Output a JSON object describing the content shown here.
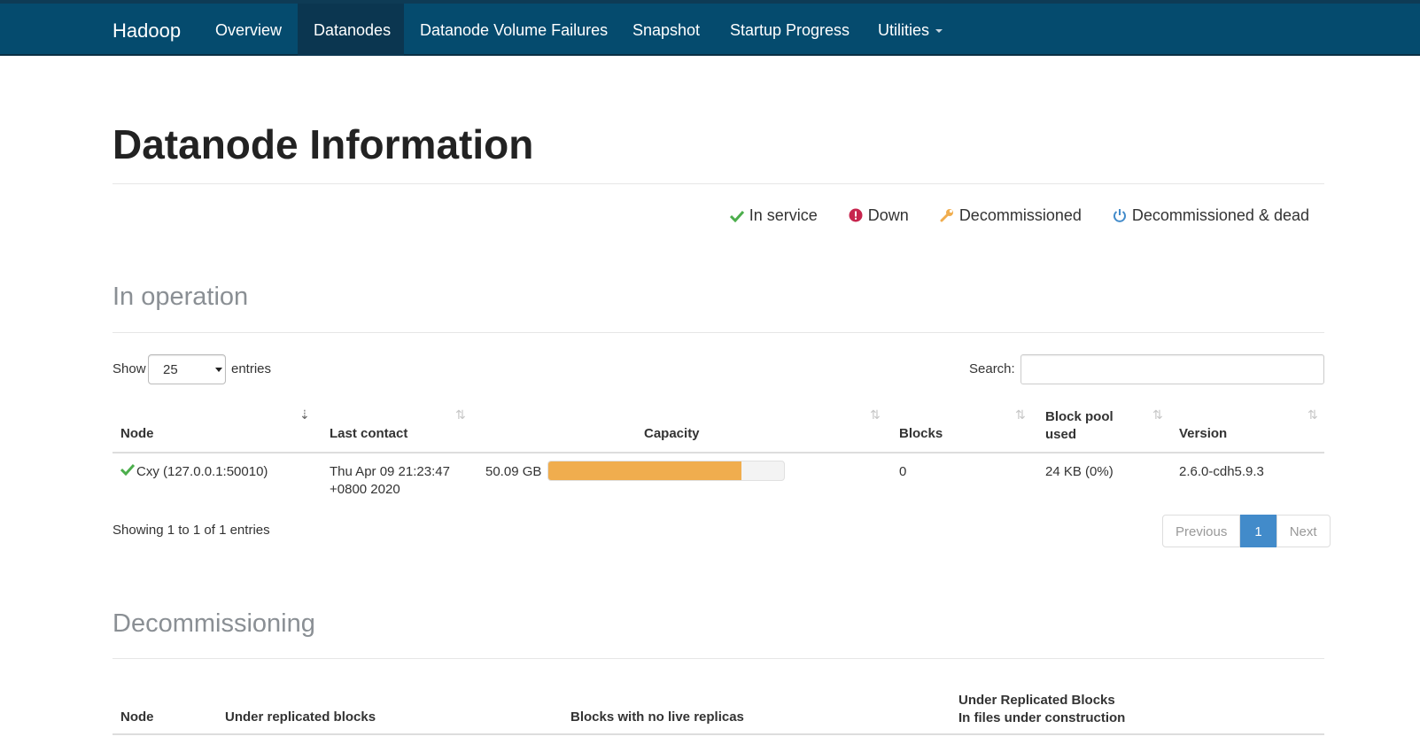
{
  "nav": {
    "brand": "Hadoop",
    "items": [
      {
        "label": "Overview",
        "active": false
      },
      {
        "label": "Datanodes",
        "active": true
      },
      {
        "label": "Datanode Volume Failures",
        "active": false
      },
      {
        "label": "Snapshot",
        "active": false
      },
      {
        "label": "Startup Progress",
        "active": false
      },
      {
        "label": "Utilities",
        "active": false,
        "dropdown": true
      }
    ]
  },
  "page_title": "Datanode Information",
  "legend": [
    {
      "icon": "check-icon",
      "label": "In service",
      "color": "#4cae4c"
    },
    {
      "icon": "exclamation-circle-icon",
      "label": "Down",
      "color": "#c7254e"
    },
    {
      "icon": "wrench-icon",
      "label": "Decommissioned",
      "color": "#f0ad4e"
    },
    {
      "icon": "power-icon",
      "label": "Decommissioned & dead",
      "color": "#428bca"
    }
  ],
  "in_operation": {
    "title": "In operation",
    "show_label": "Show",
    "entries_value": "25",
    "entries_label": "entries",
    "search_label": "Search:",
    "search_value": "",
    "columns": [
      "Node",
      "Last contact",
      "Capacity",
      "Blocks",
      "Block pool used",
      "Version"
    ],
    "rows": [
      {
        "status_icon": "check-icon",
        "node": "Cxy (127.0.0.1:50010)",
        "last_contact_line1": "Thu Apr 09 21:23:47",
        "last_contact_line2": "+0800 2020",
        "capacity": "50.09 GB",
        "capacity_used_fraction": 0.82,
        "blocks": "0",
        "block_pool_used": "24 KB (0%)",
        "version": "2.6.0-cdh5.9.3"
      }
    ],
    "info": "Showing 1 to 1 of 1 entries",
    "pagination": {
      "previous": "Previous",
      "current": "1",
      "next": "Next"
    }
  },
  "decommissioning": {
    "title": "Decommissioning",
    "columns": [
      "Node",
      "Under replicated blocks",
      "Blocks with no live replicas",
      "Under Replicated Blocks",
      "In files under construction"
    ]
  },
  "colors": {
    "navbar": "#054b6e",
    "nav_active": "#0b3650",
    "capacity_bar": "#f0ad4e",
    "page_active": "#428bca"
  }
}
